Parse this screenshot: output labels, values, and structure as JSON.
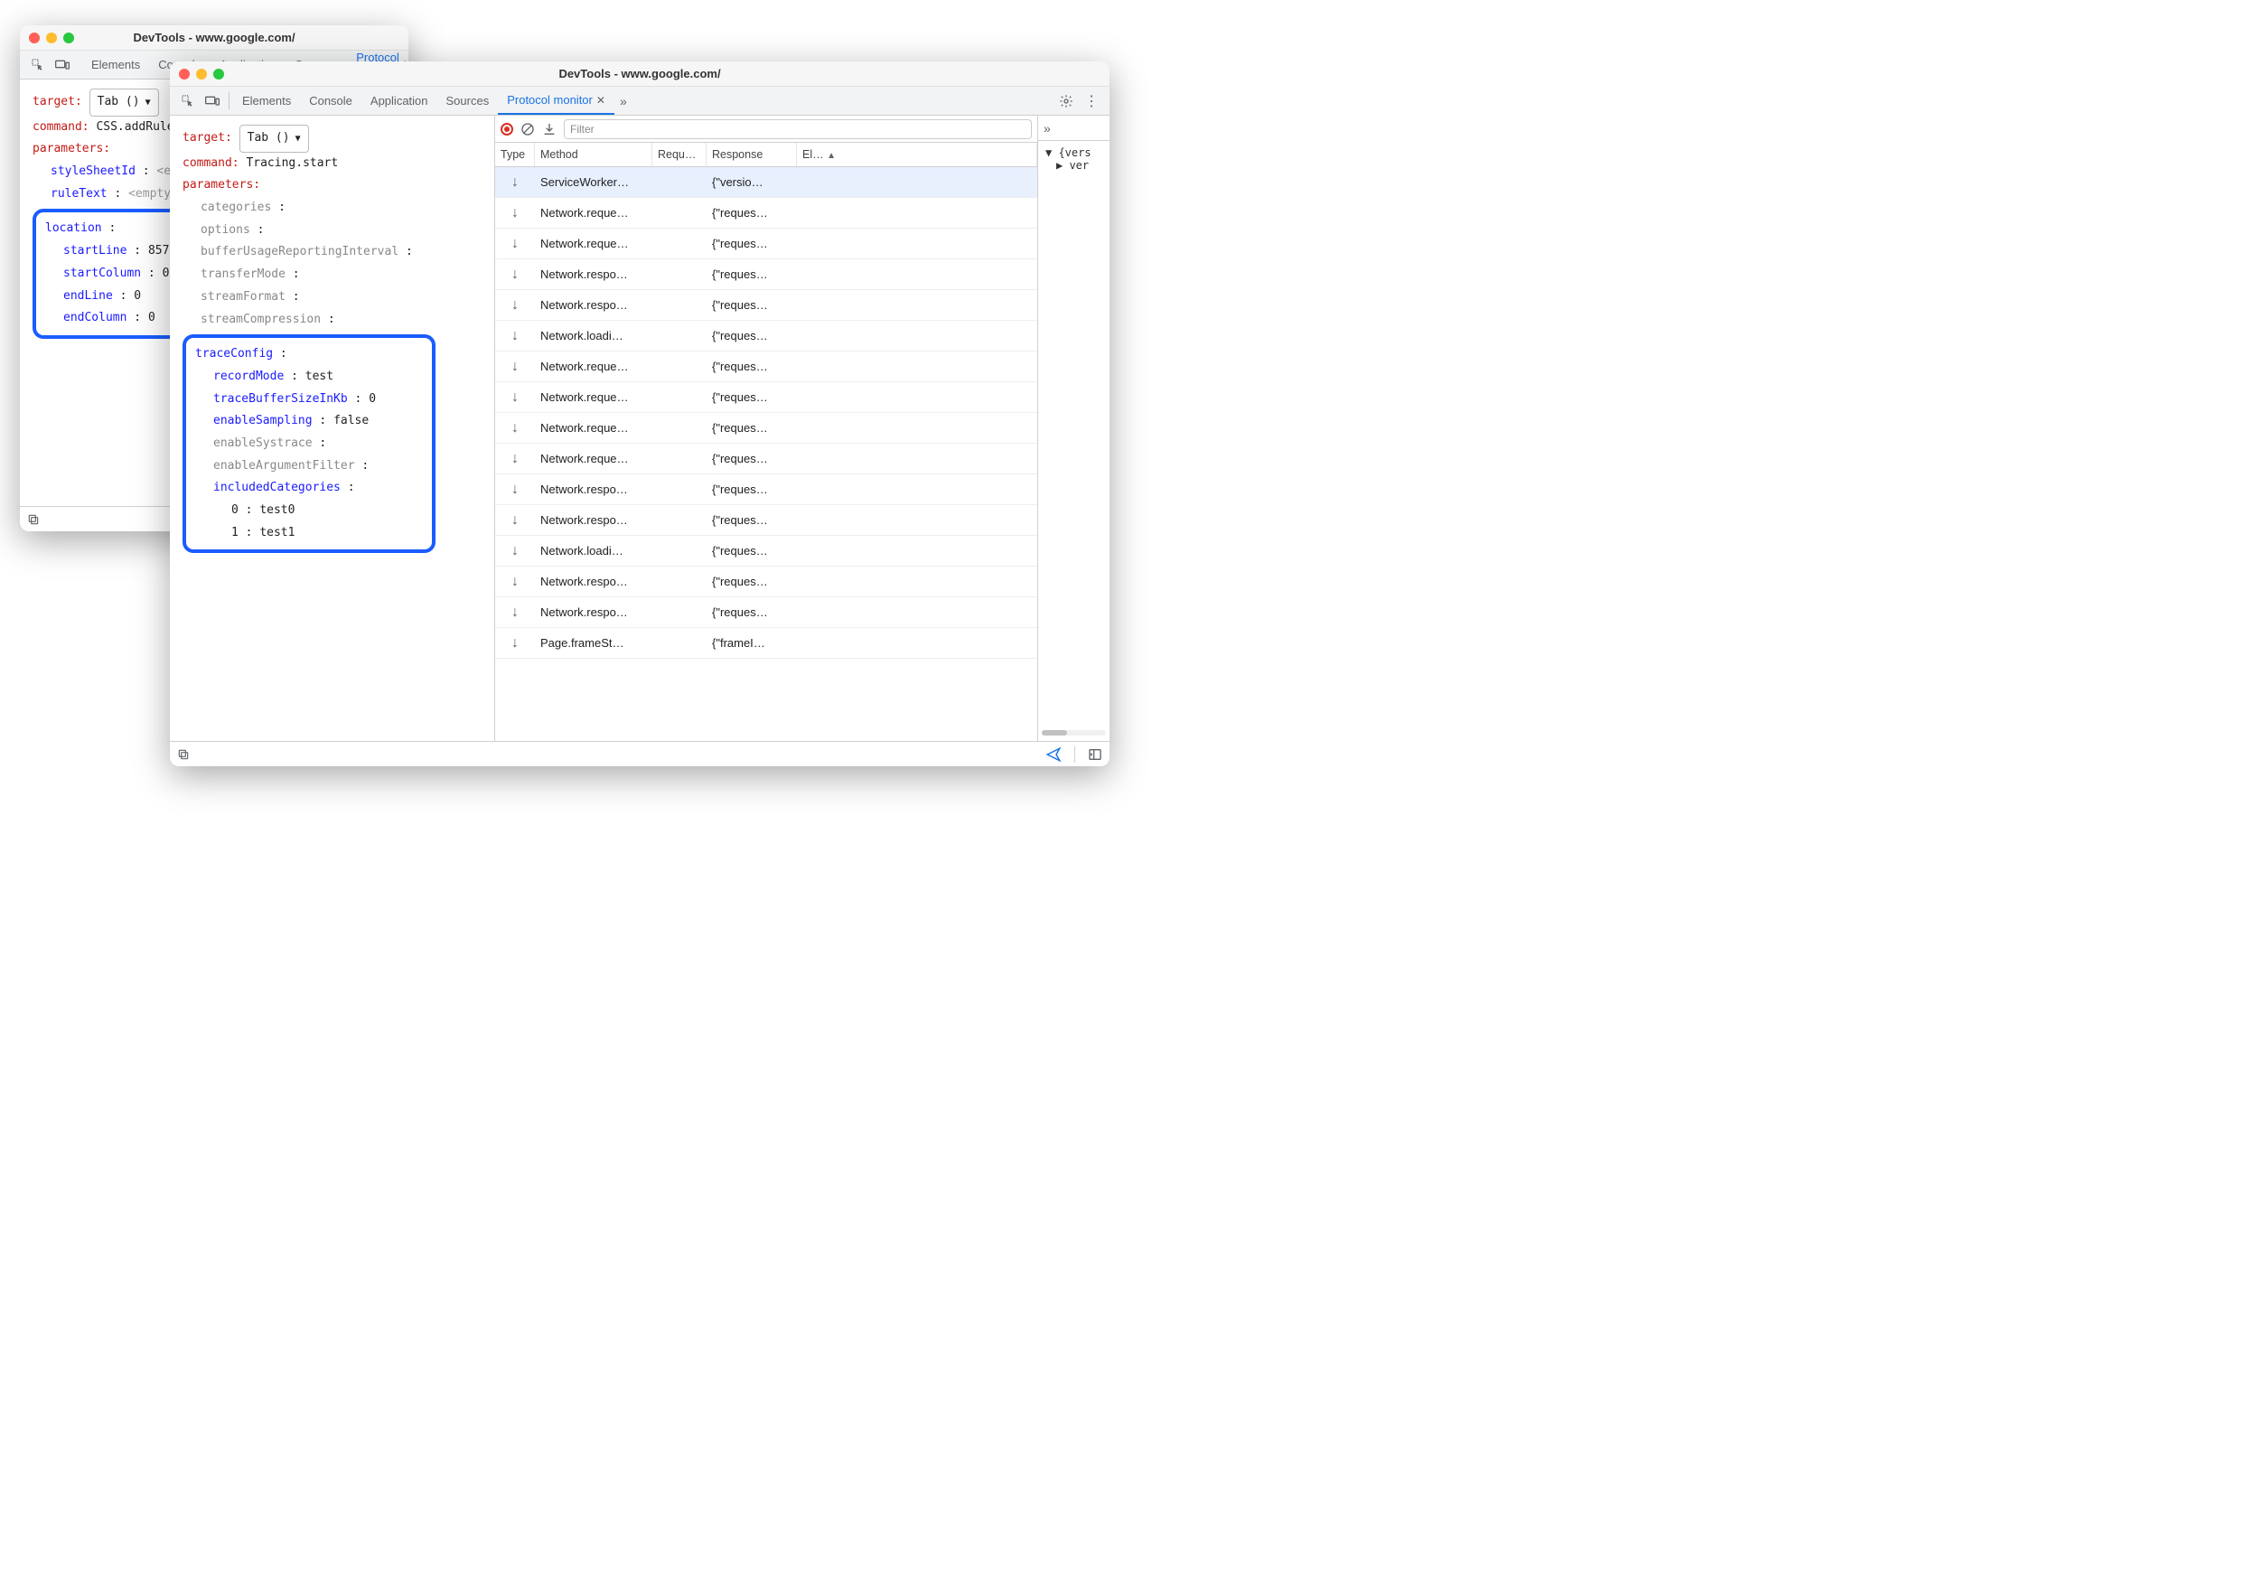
{
  "window1": {
    "title": "DevTools - www.google.com/",
    "tabs": [
      "Elements",
      "Console",
      "Application",
      "Sources",
      "Protocol monitor"
    ],
    "activeTab": "Protocol monitor",
    "editor": {
      "targetLabel": "target",
      "targetValue": "Tab ()",
      "commandLabel": "command",
      "commandValue": "CSS.addRule",
      "parametersLabel": "parameters",
      "params": [
        {
          "key": "styleSheetId",
          "value": "<empty_string>",
          "hint": true
        },
        {
          "key": "ruleText",
          "value": "<empty_string>",
          "hint": true
        }
      ],
      "highlight": {
        "key": "location",
        "children": [
          {
            "key": "startLine",
            "value": "857"
          },
          {
            "key": "startColumn",
            "value": "0"
          },
          {
            "key": "endLine",
            "value": "0"
          },
          {
            "key": "endColumn",
            "value": "0"
          }
        ]
      }
    }
  },
  "window2": {
    "title": "DevTools - www.google.com/",
    "tabs": [
      "Elements",
      "Console",
      "Application",
      "Sources",
      "Protocol monitor"
    ],
    "activeTab": "Protocol monitor",
    "editor": {
      "targetLabel": "target",
      "targetValue": "Tab ()",
      "commandLabel": "command",
      "commandValue": "Tracing.start",
      "parametersLabel": "parameters",
      "params": [
        {
          "key": "categories",
          "value": "",
          "gray": true
        },
        {
          "key": "options",
          "value": "",
          "gray": true
        },
        {
          "key": "bufferUsageReportingInterval",
          "value": "",
          "gray": true
        },
        {
          "key": "transferMode",
          "value": "",
          "gray": true
        },
        {
          "key": "streamFormat",
          "value": "",
          "gray": true
        },
        {
          "key": "streamCompression",
          "value": "",
          "gray": true
        }
      ],
      "highlight": {
        "key": "traceConfig",
        "children": [
          {
            "key": "recordMode",
            "value": "test",
            "blue": true
          },
          {
            "key": "traceBufferSizeInKb",
            "value": "0",
            "blue": true
          },
          {
            "key": "enableSampling",
            "value": "false",
            "blue": true
          },
          {
            "key": "enableSystrace",
            "value": "",
            "gray": true
          },
          {
            "key": "enableArgumentFilter",
            "value": "",
            "gray": true
          },
          {
            "key": "includedCategories",
            "value": "",
            "blue": true,
            "children": [
              {
                "key": "0",
                "value": "test0"
              },
              {
                "key": "1",
                "value": "test1"
              }
            ]
          }
        ]
      }
    },
    "toolbar": {
      "filterPlaceholder": "Filter"
    },
    "columns": [
      "Type",
      "Method",
      "Requ…",
      "Response",
      "El…"
    ],
    "rows": [
      {
        "method": "ServiceWorker…",
        "response": "{\"versio…",
        "sel": true
      },
      {
        "method": "Network.reque…",
        "response": "{\"reques…"
      },
      {
        "method": "Network.reque…",
        "response": "{\"reques…"
      },
      {
        "method": "Network.respo…",
        "response": "{\"reques…"
      },
      {
        "method": "Network.respo…",
        "response": "{\"reques…"
      },
      {
        "method": "Network.loadi…",
        "response": "{\"reques…"
      },
      {
        "method": "Network.reque…",
        "response": "{\"reques…"
      },
      {
        "method": "Network.reque…",
        "response": "{\"reques…"
      },
      {
        "method": "Network.reque…",
        "response": "{\"reques…"
      },
      {
        "method": "Network.reque…",
        "response": "{\"reques…"
      },
      {
        "method": "Network.respo…",
        "response": "{\"reques…"
      },
      {
        "method": "Network.respo…",
        "response": "{\"reques…"
      },
      {
        "method": "Network.loadi…",
        "response": "{\"reques…"
      },
      {
        "method": "Network.respo…",
        "response": "{\"reques…"
      },
      {
        "method": "Network.respo…",
        "response": "{\"reques…"
      },
      {
        "method": "Page.frameSt…",
        "response": "{\"frameI…"
      }
    ],
    "sidebar": {
      "root": "{vers",
      "child": "ver"
    }
  }
}
